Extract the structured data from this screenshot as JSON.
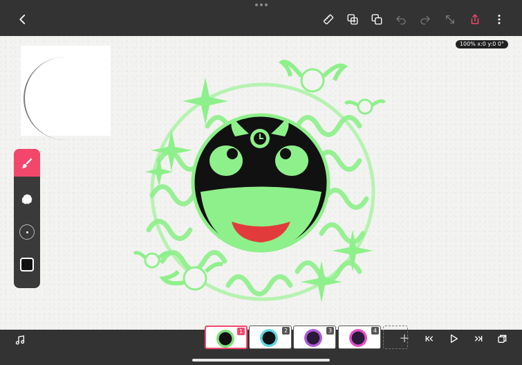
{
  "topbar": {
    "back_button": "back-icon",
    "right_tools": [
      "ruler-icon",
      "copy-layers-icon",
      "layers-icon",
      "undo-icon",
      "redo-icon",
      "resize-icon",
      "share-icon",
      "more-icon"
    ]
  },
  "canvas": {
    "zoom_status": "100% x:0 y:0 0°"
  },
  "toolbar": {
    "tools": [
      "brush-icon",
      "eraser-icon",
      "brush-size-icon",
      "color-swatch-icon"
    ],
    "active_tool": "brush",
    "current_color": "#111111"
  },
  "timeline": {
    "frames": [
      {
        "number": "1",
        "selected": true,
        "accent": "#7be27a"
      },
      {
        "number": "2",
        "selected": false,
        "accent": "#5fd4e6"
      },
      {
        "number": "3",
        "selected": false,
        "accent": "#b05ad6"
      },
      {
        "number": "4",
        "selected": false,
        "accent": "#e04fc8"
      }
    ],
    "add_label": "+"
  },
  "colors": {
    "accent": "#f2476b",
    "bar": "#333333",
    "art_green": "#8ef08a"
  }
}
